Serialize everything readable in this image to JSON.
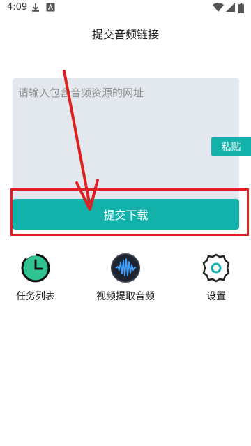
{
  "status_bar": {
    "time": "4:09",
    "icons": [
      "download-icon",
      "text-a-icon",
      "wifi-icon",
      "signal-icon",
      "battery-icon"
    ]
  },
  "app_bar": {
    "title": "提交音频链接"
  },
  "input": {
    "placeholder": "请输入包含音频资源的网址"
  },
  "buttons": {
    "paste_label": "粘贴",
    "submit_label": "提交下载"
  },
  "bottom_nav": [
    {
      "label": "任务列表",
      "icon": "task-list-timer-icon"
    },
    {
      "label": "视频提取音频",
      "icon": "audio-waveform-icon"
    },
    {
      "label": "设置",
      "icon": "settings-gear-icon"
    }
  ],
  "colors": {
    "accent": "#12b2aa",
    "input_bg": "#e3e7ee",
    "annotation_red": "#e02020",
    "waveform": "#3fa0ff",
    "timer_green": "#2ec38f"
  }
}
